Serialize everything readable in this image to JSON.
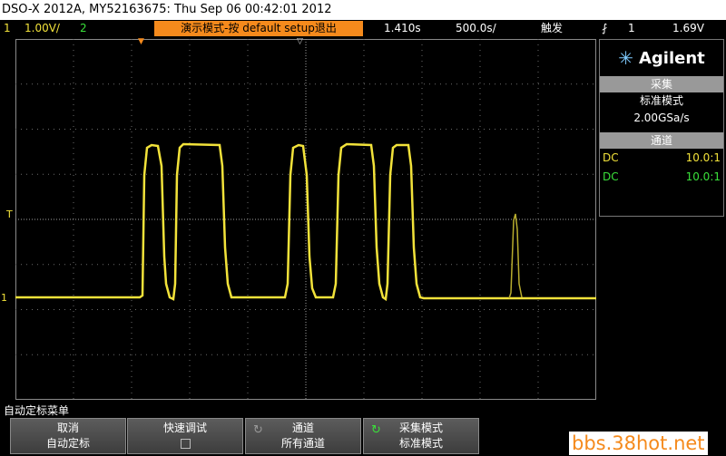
{
  "title_bar": {
    "text": "DSO-X 2012A, MY52163675: Thu Sep 06 00:42:01 2012"
  },
  "status": {
    "ch1_num": "1",
    "ch1_scale": "1.00V/",
    "ch2_num": "2",
    "demo_banner": "演示模式-按 default setup退出",
    "time_pos": "1.410s",
    "time_scale": "500.0s/",
    "trig_mode": "触发",
    "trig_src": "1",
    "trig_level": "1.69V"
  },
  "panel": {
    "brand": "Agilent",
    "acq_header": "采集",
    "acq_mode": "标准模式",
    "sample_rate": "2.00GSa/s",
    "chan_header": "通道",
    "ch1_coupling": "DC",
    "ch1_probe": "10.0:1",
    "ch2_coupling": "DC",
    "ch2_probe": "10.0:1"
  },
  "menu": {
    "title": "自动定标菜单",
    "key1_line1": "取消",
    "key1_line2": "自动定标",
    "key2_line1": "快速调试",
    "key3_line1": "通道",
    "key3_line2": "所有通道",
    "key4_line1": "采集模式",
    "key4_line2": "标准模式"
  },
  "markers": {
    "trigger": "T",
    "ch1": "1"
  },
  "watermark": "bbs.38hot.net",
  "colors": {
    "ch1": "#f2e23a",
    "ch2": "#3ae03a",
    "banner": "#f58a1c"
  }
}
